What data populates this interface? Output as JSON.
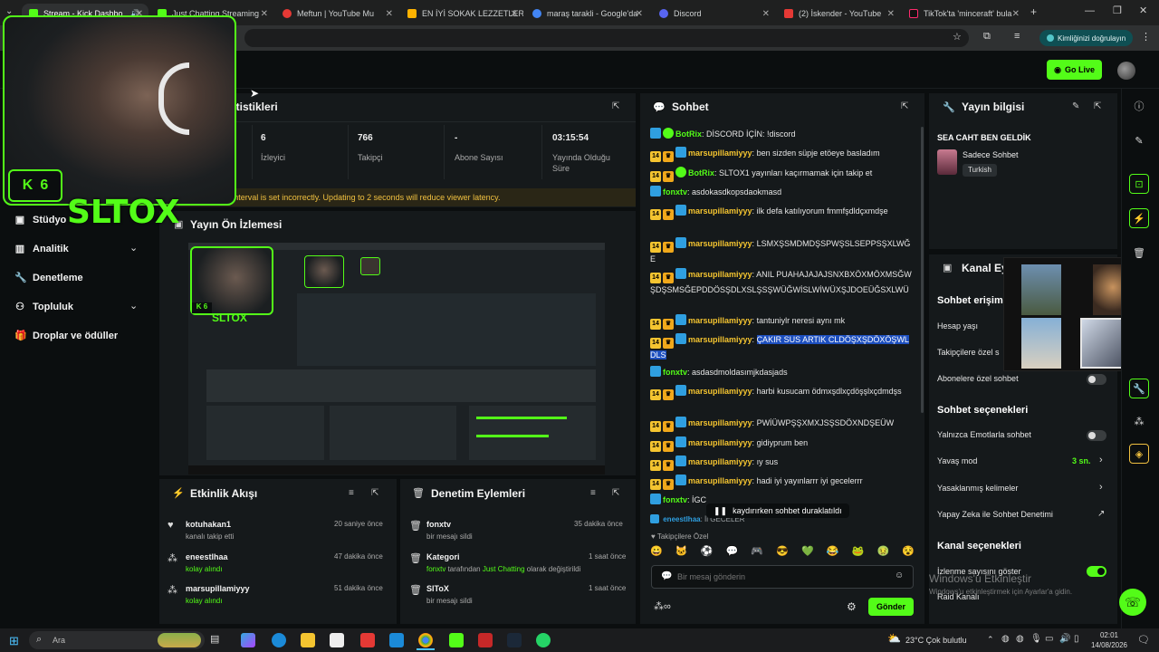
{
  "browser": {
    "tabs": [
      {
        "label": "Stream - Kick Dashbo",
        "color": "#53fc18",
        "active": true
      },
      {
        "label": "Just Chatting Streaming",
        "color": "#53fc18"
      },
      {
        "label": "Meftun | YouTube Mu",
        "color": "#e53935"
      },
      {
        "label": "EN İYİ SOKAK LEZZETLER",
        "color": "#ffb300"
      },
      {
        "label": "maraş tarakli - Google'da",
        "color": "#4285f4"
      },
      {
        "label": "Discord",
        "color": "#5865f2"
      },
      {
        "label": "(2) İskender - YouTube",
        "color": "#e53935"
      },
      {
        "label": "TikTok'ta 'minceraft' bula",
        "color": "#111111"
      }
    ],
    "verify_label": "Kimliğinizi doğrulayın"
  },
  "topbar": {
    "go_live": "Go Live"
  },
  "webcam": {
    "streamer_name": "SLTOX",
    "badge_count": "6"
  },
  "nav": [
    {
      "label": "Stüdyo",
      "icon": "studio-icon"
    },
    {
      "label": "Analitik",
      "icon": "analytics-icon",
      "chevron": true
    },
    {
      "label": "Denetleme",
      "icon": "wrench-icon"
    },
    {
      "label": "Topluluk",
      "icon": "community-icon",
      "chevron": true
    },
    {
      "label": "Droplar ve ödüller",
      "icon": "gift-icon"
    }
  ],
  "stats": {
    "title_fragment": "atistikleri",
    "items": [
      {
        "value": "6",
        "label": "İzleyici"
      },
      {
        "value": "766",
        "label": "Takipçi"
      },
      {
        "value": "-",
        "label": "Abone Sayısı"
      },
      {
        "value": "03:15:54",
        "label": "Yayında Olduğu Süre"
      }
    ],
    "warning": "Your keyframe interval is set incorrectly. Updating to 2 seconds will reduce viewer latency."
  },
  "preview": {
    "title": "Yayın Ön İzlemesi",
    "streamer_name": "SLTOX",
    "badge_count": "6"
  },
  "activity": {
    "title": "Etkinlik Akışı",
    "rows": [
      {
        "name": "kotuhakan1",
        "sub": "kanalı takip etti",
        "time": "20 saniye önce",
        "icon": "heart-icon"
      },
      {
        "name": "eneestlhaa",
        "sub": "kolay alındı",
        "time": "47 dakika önce",
        "icon": "reward-icon"
      },
      {
        "name": "marsupillamiyyy",
        "sub": "kolay alındı",
        "time": "51 dakika önce",
        "icon": "reward-icon"
      }
    ]
  },
  "moderation": {
    "title": "Denetim Eylemleri",
    "rows": [
      {
        "name": "fonxtv",
        "sub": "bir mesajı sildi",
        "time": "35 dakika önce",
        "icon": "trash-icon"
      },
      {
        "name": "Kategori",
        "sub_pre": "fonxtv",
        "sub_mid": " tarafından ",
        "sub_cat": "Just Chatting",
        "sub_post": " olarak değiştirildi",
        "time": "1 saat önce",
        "icon": "trash-icon"
      },
      {
        "name": "SlToX",
        "sub": "bir mesajı sildi",
        "time": "1 saat önce",
        "icon": "trash-icon"
      }
    ]
  },
  "chat": {
    "title": "Sohbet",
    "messages": [
      {
        "badges": "bot",
        "user": "BotRix",
        "color": "#53fc18",
        "text": "DİSCORD İÇİN: !discord"
      },
      {
        "badges": "sub",
        "user": "marsupillamiyyy",
        "color": "#f4c430",
        "text": "ben sizden süpje etöeye basladım"
      },
      {
        "badges": "subbot",
        "user": "BotRix",
        "color": "#53fc18",
        "text": "SLTOX1 yayınları kaçırmamak için takip et"
      },
      {
        "badges": "mod",
        "user": "fonxtv",
        "color": "#53fc18",
        "text": "asdokasdkopsdaokmasd"
      },
      {
        "badges": "sub",
        "user": "marsupillamiyyy",
        "color": "#f4c430",
        "text": "ilk defa katılıyorum fmmfşdldçxmdşe"
      },
      {
        "badges": "sub",
        "user": "marsupillamiyyy",
        "color": "#f4c430",
        "text": "LSMXŞSMDMDŞSPWŞSLSEPPSŞXLWĞE"
      },
      {
        "badges": "sub",
        "user": "marsupillamiyyy",
        "color": "#f4c430",
        "text": "ANIL PUAHAJAJAJSNXBXÖXMÖXMSĞWŞDŞSMSĞEPDDÖSŞDLXSLŞSŞWÜĞWİSLWİWÜXŞJDOEÜĞSXLWÜ"
      },
      {
        "badges": "sub",
        "user": "marsupillamiyyy",
        "color": "#f4c430",
        "text": "tantuniylr neresi aynı mk"
      },
      {
        "badges": "sub",
        "user": "marsupillamiyyy",
        "color": "#f4c430",
        "text": "ÇAKIR SUS ARTIK CLDÖŞXŞDÖXÖŞWLDLS",
        "selected": true
      },
      {
        "badges": "mod",
        "user": "fonxtv",
        "color": "#53fc18",
        "text": "asdasdmoldasımjkdasjads"
      },
      {
        "badges": "sub",
        "user": "marsupillamiyyy",
        "color": "#f4c430",
        "text": "harbi kusucam ödmxşdlxçdöşşlxçdmdşs"
      },
      {
        "badges": "sub",
        "user": "marsupillamiyyy",
        "color": "#f4c430",
        "text": "PWİÜWPŞŞXMXJSŞSDÖXNDŞEÜW"
      },
      {
        "badges": "sub",
        "user": "marsupillamiyyy",
        "color": "#f4c430",
        "text": "gidiyprum ben"
      },
      {
        "badges": "sub",
        "user": "marsupillamiyyy",
        "color": "#f4c430",
        "text": "ıy sus"
      },
      {
        "badges": "sub",
        "user": "marsupillamiyyy",
        "color": "#f4c430",
        "text": "hadi iyi yayınlarrr iyi gecelerrr"
      },
      {
        "badges": "mod",
        "user": "fonxtv",
        "color": "#53fc18",
        "text": "İGC"
      }
    ],
    "paused_label": "kaydırırken sohbet duraklatıldı",
    "partial_user": "eneestlhaa",
    "partial_text": "İi GECELER",
    "followers_only": "Takipçilere Özel",
    "emotes": [
      "😀",
      "🐱",
      "⚽",
      "💬",
      "🎮",
      "😎",
      "💚",
      "😂",
      "🐸",
      "🤢",
      "😵"
    ],
    "input_placeholder": "Bir mesaj gönderin",
    "send_label": "Gönder"
  },
  "stream_info": {
    "title": "Yayın bilgisi",
    "stream_title": "SEA CAHT BEN GELDİK",
    "category": "Sadece Sohbet",
    "language": "Turkish"
  },
  "channel_actions": {
    "title_fragment": "Kanal Ey",
    "chat_access_fragment": "Sohbet erişimi",
    "account_age": "Hesap yaşı",
    "follower_only_fragment": "Takipçilere özel s",
    "subscriber_chat": "Abonelere özel sohbet",
    "chat_options_title": "Sohbet seçenekleri",
    "emote_only": "Yalnızca Emotlarla sohbet",
    "slow_mode": "Yavaş mod",
    "slow_mode_value": "3 sn.",
    "banned_words": "Yasaklanmış kelimeler",
    "ai_moderation": "Yapay Zeka ile Sohbet Denetimi",
    "channel_options_title": "Kanal seçenekleri",
    "show_viewer_count": "İzlenme sayısını göster",
    "raid_label": "Raid Kanalı"
  },
  "windows_watermark": {
    "line1": "Windows'u Etkinleştir",
    "line2": "Windows'u etkinleştirmek için Ayarlar'a gidin."
  },
  "taskbar": {
    "search_placeholder": "Ara",
    "weather": "23°C  Çok bulutlu",
    "time": "02:01",
    "date": "14/08/2026"
  }
}
